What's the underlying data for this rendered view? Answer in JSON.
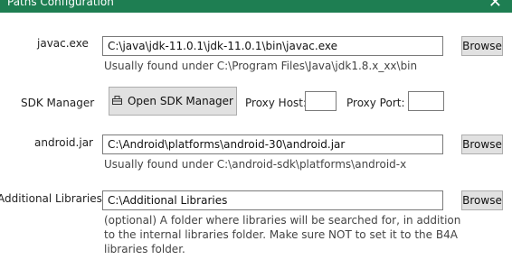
{
  "window": {
    "title": "Paths Configuration",
    "close_glyph": "✕"
  },
  "javac": {
    "label": "javac.exe",
    "value": "C:\\java\\jdk-11.0.1\\jdk-11.0.1\\bin\\javac.exe",
    "browse_label": "Browse",
    "hint": "Usually found under C:\\Program Files\\Java\\jdk1.8.x_xx\\bin"
  },
  "sdk": {
    "label": "SDK Manager",
    "button_label": "Open SDK Manager",
    "button_icon": "sdk-manager-icon",
    "proxy_host_label": "Proxy Host:",
    "proxy_host_value": "",
    "proxy_port_label": "Proxy Port:",
    "proxy_port_value": ""
  },
  "android_jar": {
    "label": "android.jar",
    "value": "C:\\Android\\platforms\\android-30\\android.jar",
    "browse_label": "Browse",
    "hint": "Usually found under C:\\android-sdk\\platforms\\android-x"
  },
  "additional_libraries": {
    "label": "Additional Libraries",
    "value": "C:\\Additional Libraries",
    "browse_label": "Browse",
    "hint": "(optional) A folder where libraries will be searched for, in addition to the internal libraries folder. Make sure NOT to set it to the B4A libraries folder."
  }
}
